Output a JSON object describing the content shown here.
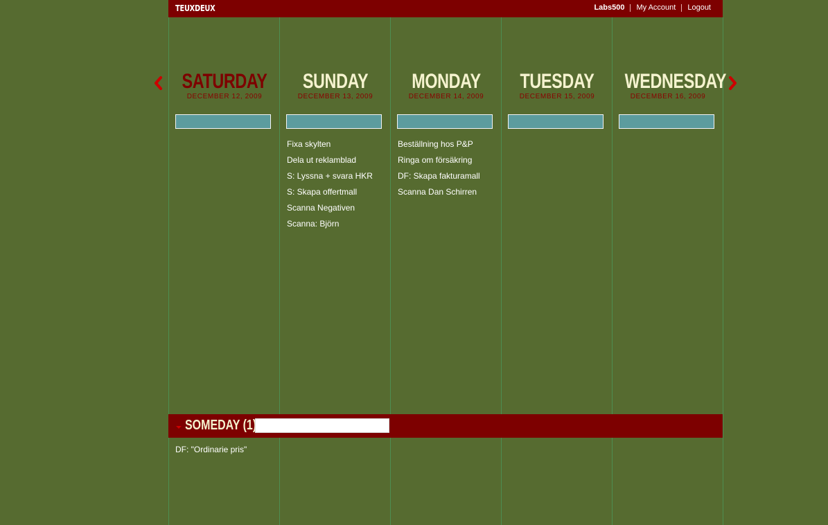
{
  "app": {
    "brand": "TEUXDEUX"
  },
  "nav": {
    "user": "Labs500",
    "account": "My Account",
    "logout": "Logout"
  },
  "colors": {
    "background": "#566b30",
    "bar": "#7d0000",
    "input": "#5c9c9e",
    "accent_arrow": "#cc0000"
  },
  "icons": {
    "prev": "chevron-left-icon",
    "next": "chevron-right-icon",
    "someday_toggle": "caret-down-icon"
  },
  "days": [
    {
      "name": "SATURDAY",
      "date": "DECEMBER 12, 2009",
      "current": true,
      "todos": []
    },
    {
      "name": "SUNDAY",
      "date": "DECEMBER 13, 2009",
      "current": false,
      "todos": [
        "Fixa skylten",
        "Dela ut reklamblad",
        "S: Lyssna + svara HKR",
        "S: Skapa offertmall",
        "Scanna Negativen",
        "Scanna: Björn"
      ]
    },
    {
      "name": "MONDAY",
      "date": "DECEMBER 14, 2009",
      "current": false,
      "todos": [
        "Beställning hos P&P",
        "Ringa om försäkring",
        "DF: Skapa fakturamall",
        "Scanna Dan Schirren"
      ]
    },
    {
      "name": "TUESDAY",
      "date": "DECEMBER 15, 2009",
      "current": false,
      "todos": []
    },
    {
      "name": "WEDNESDAY",
      "date": "DECEMBER 16, 2009",
      "current": false,
      "todos": []
    }
  ],
  "someday": {
    "title": "SOMEDAY (1)",
    "input_value": "",
    "todos": [
      "DF: \"Ordinarie pris\""
    ]
  }
}
